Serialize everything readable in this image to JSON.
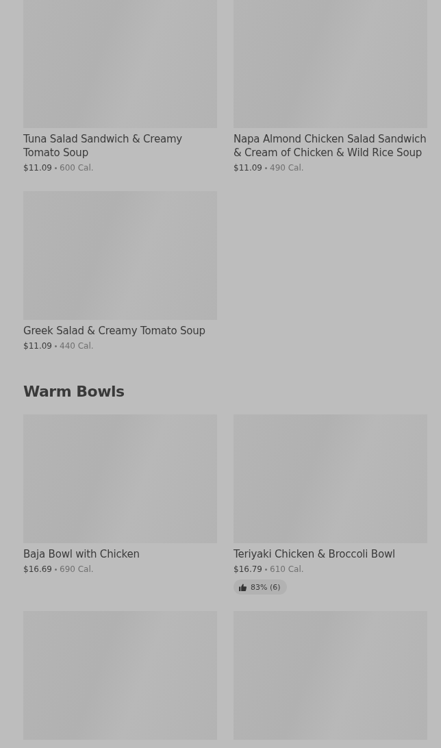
{
  "sections": [
    {
      "items": [
        {
          "kind": "dish",
          "title": "Tuna Salad Sandwich & Creamy Tomato Soup",
          "price": "$11.09",
          "calories": "600 Cal."
        },
        {
          "kind": "dish",
          "title": "Napa Almond Chicken Salad Sandwich & Cream of Chicken & Wild Rice Soup",
          "price": "$11.09",
          "calories": "490 Cal."
        },
        {
          "kind": "dish",
          "title": "Greek Salad & Creamy Tomato Soup",
          "price": "$11.09",
          "calories": "440 Cal."
        }
      ]
    },
    {
      "heading": "Warm Bowls",
      "items": [
        {
          "kind": "dish",
          "title": "Baja Bowl with Chicken",
          "price": "$16.69",
          "calories": "690 Cal."
        },
        {
          "kind": "dish",
          "title": "Teriyaki Chicken & Broccoli Bowl",
          "price": "$16.79",
          "calories": "610 Cal.",
          "rating": "83% (6)"
        },
        {
          "kind": "image_only"
        },
        {
          "kind": "image_only"
        }
      ]
    }
  ]
}
